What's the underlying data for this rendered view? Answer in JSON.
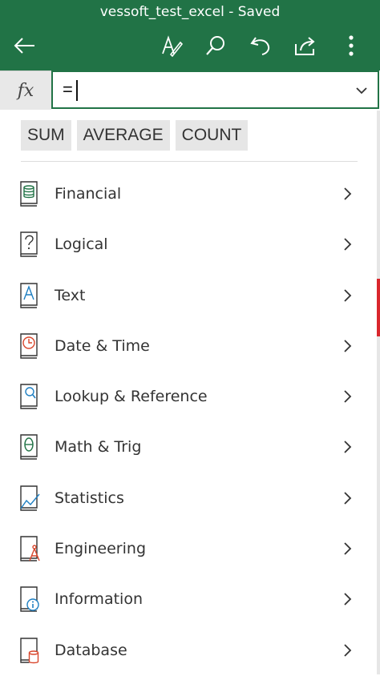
{
  "window": {
    "title": "vessoft_test_excel - Saved"
  },
  "header": {
    "icons": [
      "back-arrow-icon",
      "ink-pen-icon",
      "search-icon",
      "undo-icon",
      "share-icon",
      "more-vert-icon"
    ]
  },
  "formula_bar": {
    "fx_label": "fx",
    "value": "=",
    "dropdown_icon": "chevron-down-icon"
  },
  "quick_functions": [
    {
      "label": "SUM"
    },
    {
      "label": "AVERAGE"
    },
    {
      "label": "COUNT"
    }
  ],
  "categories": [
    {
      "label": "Financial",
      "icon": "financial-book-icon"
    },
    {
      "label": "Logical",
      "icon": "logical-book-icon"
    },
    {
      "label": "Text",
      "icon": "text-book-icon"
    },
    {
      "label": "Date & Time",
      "icon": "date-time-book-icon"
    },
    {
      "label": "Lookup & Reference",
      "icon": "lookup-book-icon"
    },
    {
      "label": "Math & Trig",
      "icon": "math-trig-book-icon"
    },
    {
      "label": "Statistics",
      "icon": "statistics-book-icon"
    },
    {
      "label": "Engineering",
      "icon": "engineering-book-icon"
    },
    {
      "label": "Information",
      "icon": "information-book-icon"
    },
    {
      "label": "Database",
      "icon": "database-book-icon"
    }
  ],
  "colors": {
    "brand_green": "#217346",
    "accent_blue": "#1e7fc2",
    "accent_red": "#d9462c",
    "chip_bg": "#e6e6e6"
  }
}
